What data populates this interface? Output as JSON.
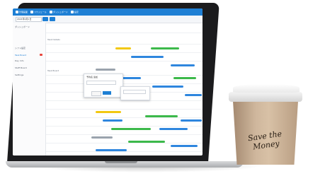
{
  "app": {
    "tabs": [
      {
        "label": "管理画面"
      },
      {
        "label": "スケジュール"
      },
      {
        "label": "ダッシュボード"
      },
      {
        "label": "設定"
      }
    ],
    "date_field": "2021年4月1日",
    "sidebar_items": [
      {
        "label": "ダッシュボード"
      },
      {
        "label": "シフト設定"
      },
      {
        "label": "Task Board"
      },
      {
        "label": "Day Info"
      },
      {
        "label": "Staff Board"
      },
      {
        "label": "Settings"
      }
    ],
    "section_labels": [
      "Task Details",
      "Task Board"
    ],
    "popup": {
      "title": "予約名 追加",
      "ok": "",
      "cancel": ""
    }
  },
  "cup": {
    "text": "Save the Money"
  },
  "colors": {
    "app_header": "#1e7fd4",
    "bar_blue": "#2e86de",
    "bar_green": "#3cb94a",
    "bar_yellow": "#f2c811",
    "cup": "#cfb79d"
  }
}
